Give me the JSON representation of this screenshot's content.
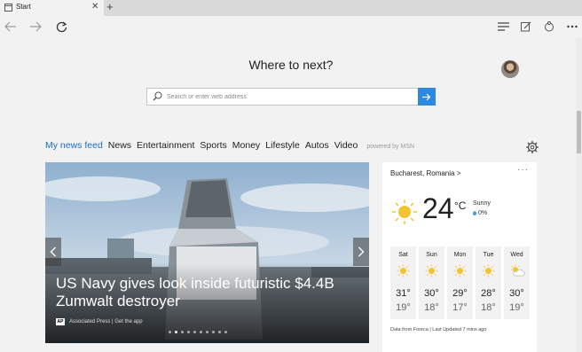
{
  "tab": {
    "title": "Start",
    "close": "✕",
    "new": "+"
  },
  "page": {
    "heading": "Where to next?"
  },
  "search": {
    "placeholder": "Search or enter web address"
  },
  "news_nav": {
    "items": [
      "My news feed",
      "News",
      "Entertainment",
      "Sports",
      "Money",
      "Lifestyle",
      "Autos",
      "Video"
    ],
    "powered_by": "powered by MSN"
  },
  "hero": {
    "title": "US Navy gives look inside futuristic $4.4B Zumwalt destroyer",
    "source": "Associated Press | Get the app",
    "source_logo": "AP",
    "slide_count": 10,
    "active_slide": 2
  },
  "weather": {
    "location": "Bucharest, Romania",
    "location_chevron": ">",
    "more": "···",
    "temp": "24",
    "unit": "°C",
    "condition": "Sunny",
    "precip": "0%",
    "days": [
      {
        "name": "Sat",
        "hi": "31°",
        "lo": "19°",
        "icon": "sun-icon"
      },
      {
        "name": "Sun",
        "hi": "30°",
        "lo": "18°",
        "icon": "sun-icon"
      },
      {
        "name": "Mon",
        "hi": "29°",
        "lo": "17°",
        "icon": "sun-icon"
      },
      {
        "name": "Tue",
        "hi": "28°",
        "lo": "18°",
        "icon": "sun-icon"
      },
      {
        "name": "Wed",
        "hi": "30°",
        "lo": "19°",
        "icon": "partly-sunny-icon"
      }
    ],
    "footer": "Data from Foreca | Last Updated 7 mins ago"
  },
  "colors": {
    "accent": "#2b8ae0",
    "active_link": "#1a6fc2",
    "sun": "#f2c530"
  }
}
